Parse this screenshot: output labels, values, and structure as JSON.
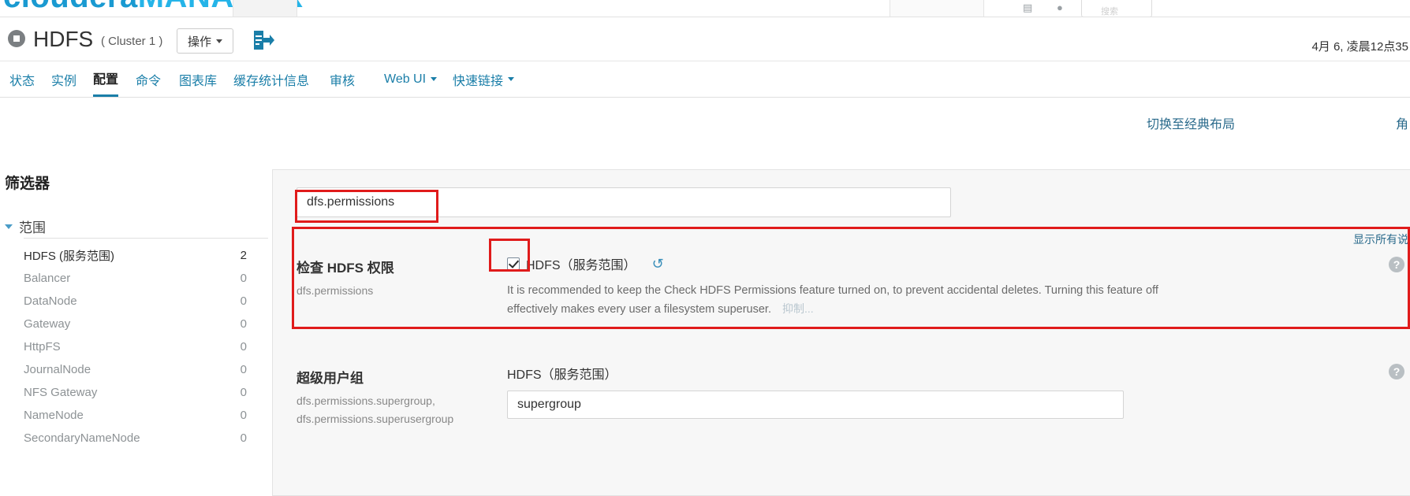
{
  "brand": {
    "word1": "cloudera",
    "word2": "MANAGER",
    "color1": "#1a9ad1",
    "color2": "#25b4e8",
    "search_placeholder": "搜索"
  },
  "service_header": {
    "title": "HDFS",
    "cluster": "( Cluster 1 )",
    "actions_label": "操作",
    "export_icon": "export-icon",
    "status_icon": "service-stopped-icon",
    "date": "4月 6, 凌晨12点35"
  },
  "nav": {
    "items": [
      {
        "label": "状态",
        "active": false,
        "dropdown": false
      },
      {
        "label": "实例",
        "active": false,
        "dropdown": false
      },
      {
        "label": "配置",
        "active": true,
        "dropdown": false
      },
      {
        "label": "命令",
        "active": false,
        "dropdown": false
      },
      {
        "label": "图表库",
        "active": false,
        "dropdown": false
      },
      {
        "label": "缓存统计信息",
        "active": false,
        "dropdown": false
      },
      {
        "label": "审核",
        "active": false,
        "dropdown": false
      },
      {
        "label": "Web UI",
        "active": false,
        "dropdown": true
      },
      {
        "label": "快速链接",
        "active": false,
        "dropdown": true
      }
    ]
  },
  "toolbar": {
    "classic_layout": "切换至经典布局",
    "roles": "角"
  },
  "sidebar": {
    "title": "筛选器",
    "group_label": "范围",
    "items": [
      {
        "label": "HDFS (服务范围)",
        "count": "2",
        "selected": true
      },
      {
        "label": "Balancer",
        "count": "0",
        "selected": false
      },
      {
        "label": "DataNode",
        "count": "0",
        "selected": false
      },
      {
        "label": "Gateway",
        "count": "0",
        "selected": false
      },
      {
        "label": "HttpFS",
        "count": "0",
        "selected": false
      },
      {
        "label": "JournalNode",
        "count": "0",
        "selected": false
      },
      {
        "label": "NFS Gateway",
        "count": "0",
        "selected": false
      },
      {
        "label": "NameNode",
        "count": "0",
        "selected": false
      },
      {
        "label": "SecondaryNameNode",
        "count": "0",
        "selected": false
      }
    ]
  },
  "main": {
    "search_value": "dfs.permissions",
    "search_placeholder": "",
    "show_all": "显示所有说",
    "rows": [
      {
        "title": "检查 HDFS 权限",
        "property": "dfs.permissions",
        "scope": "HDFS（服务范围）",
        "checked": true,
        "reset_icon": "reset-icon",
        "description": "It is recommended to keep the Check HDFS Permissions feature turned on, to prevent accidental deletes. Turning this feature off effectively makes every user a filesystem superuser.",
        "suppress_label": "抑制...",
        "help_icon": "help-icon"
      },
      {
        "title": "超级用户组",
        "property": "dfs.permissions.supergroup, dfs.permissions.superusergroup",
        "property_line1": "dfs.permissions.supergroup,",
        "property_line2": "dfs.permissions.superusergroup",
        "scope": "HDFS（服务范围）",
        "value": "supergroup",
        "help_icon": "help-icon"
      }
    ]
  },
  "annotations": {
    "search_box": "red-highlight-search",
    "checkbox": "red-highlight-checkbox",
    "config_block": "red-highlight-config-row"
  }
}
